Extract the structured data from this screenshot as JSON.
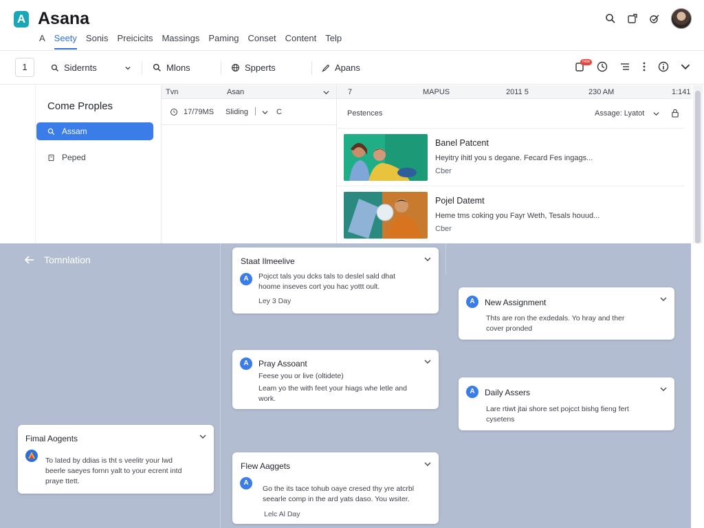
{
  "app": {
    "logo_letter": "A",
    "title": "Asana"
  },
  "nav": {
    "tabs": [
      {
        "label": "A"
      },
      {
        "label": "Seety"
      },
      {
        "label": "Sonis"
      },
      {
        "label": "Preicicits"
      },
      {
        "label": "Massings"
      },
      {
        "label": "Paming"
      },
      {
        "label": "Conset"
      },
      {
        "label": "Content"
      },
      {
        "label": "Telp"
      }
    ],
    "active_index": 1
  },
  "toolbar": {
    "count": "1",
    "items": [
      {
        "label": "Sidernts",
        "icon": "search-icon"
      },
      {
        "label": "Mlons",
        "icon": "search-icon"
      },
      {
        "label": "Spperts",
        "icon": "globe-icon"
      },
      {
        "label": "Apans",
        "icon": "pen-icon"
      }
    ],
    "notification_badge": "new"
  },
  "left_panel": {
    "title": "Come Proples",
    "items": [
      {
        "label": "Assam",
        "icon": "search-icon",
        "active": true
      },
      {
        "label": "Peped",
        "icon": "document-icon",
        "active": false
      }
    ]
  },
  "middle_panel": {
    "header": {
      "col1": "Tvn",
      "col2": "Asan"
    },
    "row": {
      "time": "17/79MS",
      "label": "Sliding",
      "tail": "C"
    }
  },
  "right_panel": {
    "header": {
      "col1": "7",
      "col2": "MAPUS",
      "col3": "2011 5",
      "col4": "230 AM",
      "col5": "1:141"
    },
    "subheader": {
      "left": "Pestences",
      "right": "Assage: Lyatot"
    },
    "feed": [
      {
        "title": "Banel Patcent",
        "desc": "Heyitry ihitl you s degane. Fecard Fes ingags...",
        "meta": "Cber"
      },
      {
        "title": "Pojel Datemt",
        "desc": "Heme tms coking you Fayr Weth, Tesals houud...",
        "meta": "Cber"
      }
    ]
  },
  "board": {
    "back_label": "Tomnlation",
    "cards": [
      {
        "title": "Staat Ilmeelive",
        "text": [
          "Pojcct tals you dcks tals to deslel sald dhat",
          "hoome inseves cort you hac yottt oult."
        ],
        "meta": "Ley 3 Day"
      },
      {
        "title": "Pray Assoant",
        "text": [
          "Feese you or live (oltidete)",
          "Leam yo the with feet your hiags whe letle and",
          "work."
        ],
        "meta": ""
      },
      {
        "title": "Flew Aaggets",
        "text": [
          "Go the its tace tohub oaye cresed thy yre atcrbl",
          "seearle comp in the ard yats daso. You wsiter."
        ],
        "meta": "Lelc Al Day"
      },
      {
        "title": "New Assignment",
        "text": [
          "Thts are ron the exdedals. Yo hray and ther",
          "cover pronded"
        ],
        "meta": ""
      },
      {
        "title": "Daily Assers",
        "text": [
          "Lare rtiwt jtai shore set pojcct bishg fieng fert",
          "cysetens"
        ],
        "meta": ""
      },
      {
        "title": "Fimal Aogents",
        "text": [
          "To lated by ddias is tht s veelitr your lwd",
          "beerle saeyes fornn yalt to your ecrent intd",
          "praye ttett."
        ],
        "meta": ""
      }
    ]
  },
  "colors": {
    "accent": "#3b7de8",
    "logo": "#1aa6b7",
    "board_bg": "#b3bdd1",
    "badge": "#e5483e"
  }
}
